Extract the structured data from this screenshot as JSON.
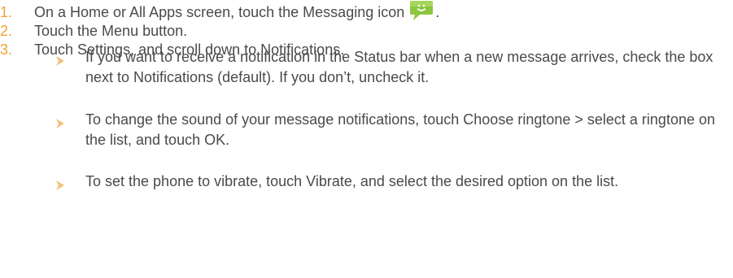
{
  "steps": [
    {
      "number": "1.",
      "text": "On a Home or All Apps screen, touch the Messaging icon",
      "icon": "messaging-icon",
      "suffix": "."
    },
    {
      "number": "2.",
      "text": "Touch the Menu button."
    },
    {
      "number": "3.",
      "text": "Touch Settings, and scroll down to Notifications."
    }
  ],
  "bullets": [
    {
      "text": "If you want to receive a notification in the Status bar when a new message arrives, check the box next to Notifications (default). If you don’t, uncheck it."
    },
    {
      "text": "To change the sound of your message notifications, touch Choose ringtone > select a ringtone on the list, and touch OK."
    },
    {
      "text": "To set the phone to vibrate, touch Vibrate, and select the desired option on the list."
    }
  ],
  "colors": {
    "number": "#f2a335",
    "bullet_arrow": "#f2c27a",
    "text": "#4a4a4a",
    "icon_green": "#8cc63f"
  }
}
